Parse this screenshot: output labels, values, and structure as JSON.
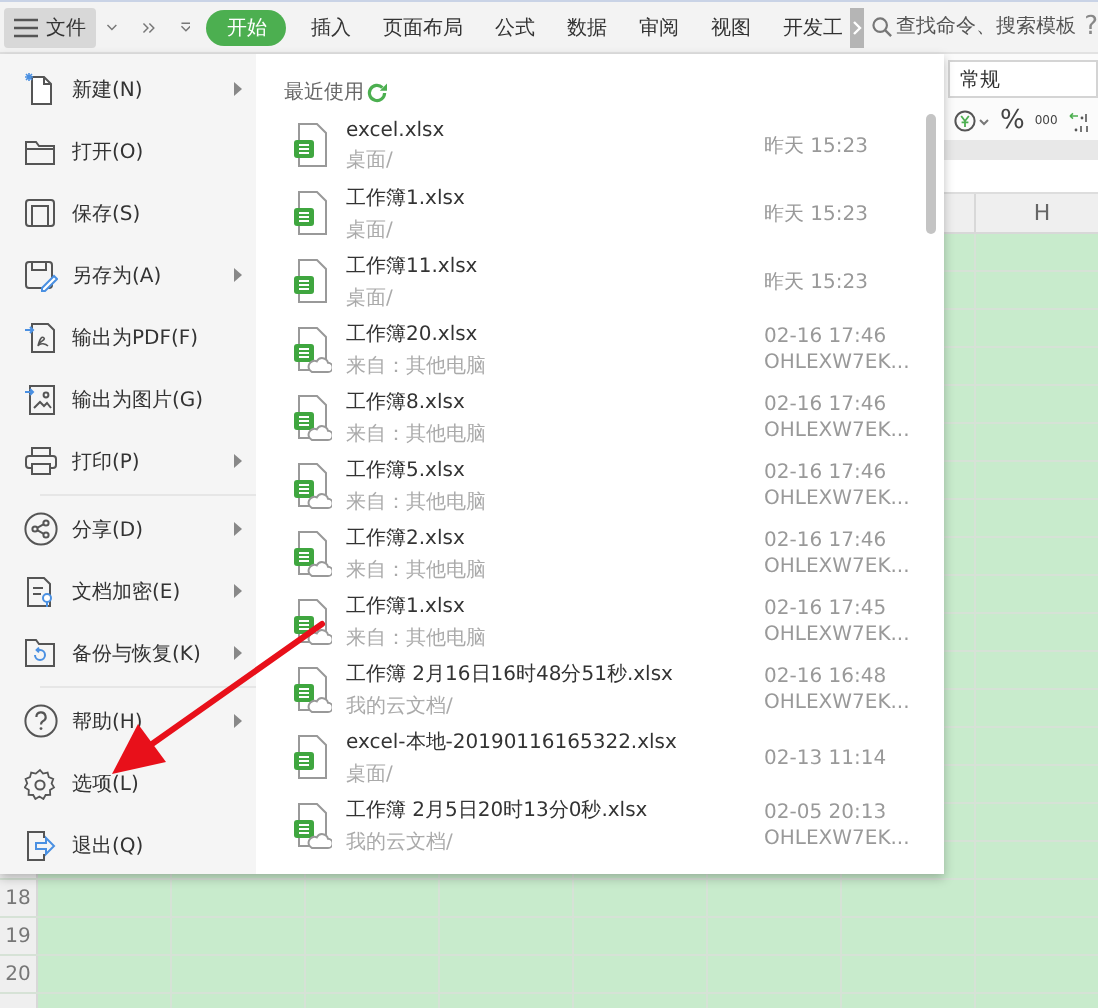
{
  "toolbar": {
    "file_button": "文件",
    "tabs": [
      {
        "label": "开始",
        "selected": true
      },
      {
        "label": "插入",
        "selected": false
      },
      {
        "label": "页面布局",
        "selected": false
      },
      {
        "label": "公式",
        "selected": false
      },
      {
        "label": "数据",
        "selected": false
      },
      {
        "label": "审阅",
        "selected": false
      },
      {
        "label": "视图",
        "selected": false
      },
      {
        "label": "开发工",
        "selected": false
      }
    ],
    "search": {
      "placeholder": "查找命令、搜索模板"
    },
    "help": "?"
  },
  "file_menu": {
    "groups": [
      [
        {
          "label": "新建(N)",
          "has_submenu": true
        },
        {
          "label": "打开(O)",
          "has_submenu": false
        },
        {
          "label": "保存(S)",
          "has_submenu": false
        },
        {
          "label": "另存为(A)",
          "has_submenu": true
        },
        {
          "label": "输出为PDF(F)",
          "has_submenu": false
        },
        {
          "label": "输出为图片(G)",
          "has_submenu": false
        },
        {
          "label": "打印(P)",
          "has_submenu": true
        }
      ],
      [
        {
          "label": "分享(D)",
          "has_submenu": true
        },
        {
          "label": "文档加密(E)",
          "has_submenu": true
        },
        {
          "label": "备份与恢复(K)",
          "has_submenu": true
        }
      ],
      [
        {
          "label": "帮助(H)",
          "has_submenu": true
        },
        {
          "label": "选项(L)",
          "has_submenu": false
        },
        {
          "label": "退出(Q)",
          "has_submenu": false
        }
      ]
    ]
  },
  "recent": {
    "title": "最近使用",
    "files": [
      {
        "name": "excel.xlsx",
        "location": "桌面/",
        "time": "昨天 15:23",
        "cloud": false
      },
      {
        "name": "工作簿1.xlsx",
        "location": "桌面/",
        "time": "昨天 15:23",
        "cloud": false
      },
      {
        "name": "工作簿11.xlsx",
        "location": "桌面/",
        "time": "昨天 15:23",
        "cloud": false
      },
      {
        "name": "工作簿20.xlsx",
        "location": "来自：其他电脑",
        "time": "02-16 17:46",
        "device": "OHLEXW7EK...",
        "cloud": true
      },
      {
        "name": "工作簿8.xlsx",
        "location": "来自：其他电脑",
        "time": "02-16 17:46",
        "device": "OHLEXW7EK...",
        "cloud": true
      },
      {
        "name": "工作簿5.xlsx",
        "location": "来自：其他电脑",
        "time": "02-16 17:46",
        "device": "OHLEXW7EK...",
        "cloud": true
      },
      {
        "name": "工作簿2.xlsx",
        "location": "来自：其他电脑",
        "time": "02-16 17:46",
        "device": "OHLEXW7EK...",
        "cloud": true
      },
      {
        "name": "工作簿1.xlsx",
        "location": "来自：其他电脑",
        "time": "02-16 17:45",
        "device": "OHLEXW7EK...",
        "cloud": true
      },
      {
        "name": "工作簿 2月16日16时48分51秒.xlsx",
        "location": "我的云文档/",
        "time": "02-16 16:48",
        "device": "OHLEXW7EK...",
        "cloud": true
      },
      {
        "name": "excel-本地-20190116165322.xlsx",
        "location": "桌面/",
        "time": "02-13 11:14",
        "cloud": false
      },
      {
        "name": "工作簿 2月5日20时13分0秒.xlsx",
        "location": "我的云文档/",
        "time": "02-05 20:13",
        "device": "OHLEXW7EK...",
        "cloud": true
      }
    ]
  },
  "ribbon": {
    "number_format": "常规",
    "percent_button": "%",
    "thousands_button": "000"
  },
  "sheet": {
    "columns": [
      "H"
    ],
    "rows": [
      "18",
      "19",
      "20"
    ]
  }
}
